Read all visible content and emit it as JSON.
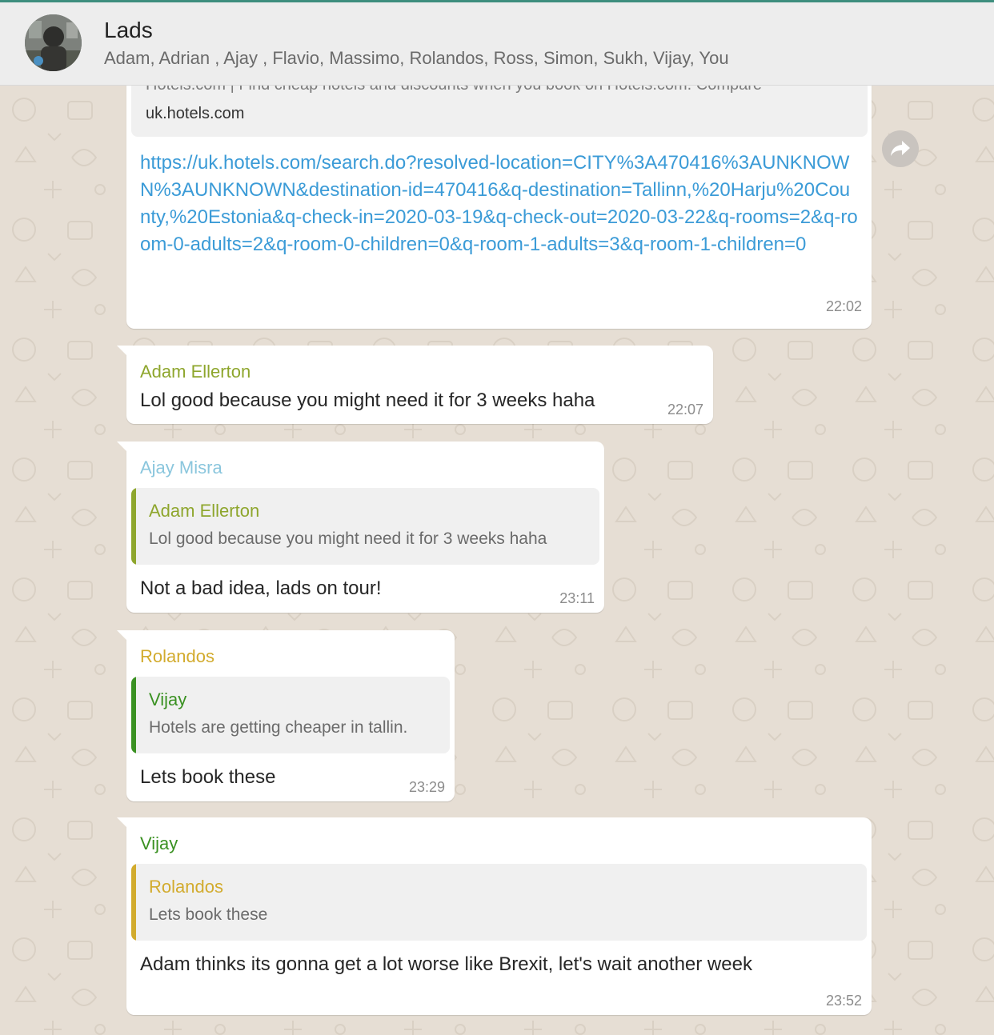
{
  "header": {
    "group_name": "Lads",
    "participants": "Adam, Adrian , Ajay , Flavio, Massimo, Rolandos, Ross, Simon, Sukh, Vijay, You",
    "avatar_icon": "group-avatar"
  },
  "colors": {
    "adam": "#8ea62d",
    "ajay": "#8ac6dd",
    "rolandos": "#d2ab2d",
    "vijay": "#3a9122",
    "link": "#3b9bd7"
  },
  "messages": {
    "m1": {
      "preview_description": "Hotels.com | Find cheap hotels and discounts when you book on Hotels.com. Compare",
      "preview_domain": "uk.hotels.com",
      "link": "https://uk.hotels.com/search.do?resolved-location=CITY%3A470416%3AUNKNOWN%3AUNKNOWN&destination-id=470416&q-destination=Tallinn,%20Harju%20County,%20Estonia&q-check-in=2020-03-19&q-check-out=2020-03-22&q-rooms=2&q-room-0-adults=2&q-room-0-children=0&q-room-1-adults=3&q-room-1-children=0",
      "time": "22:02"
    },
    "m2": {
      "sender": "Adam Ellerton",
      "text": "Lol good because you might need it for 3 weeks haha",
      "time": "22:07"
    },
    "m3": {
      "sender": "Ajay Misra",
      "quote_sender": "Adam Ellerton",
      "quote_text": "Lol good because you might need it for 3 weeks haha",
      "text": "Not a bad idea, lads on tour!",
      "time": "23:11"
    },
    "m4": {
      "sender": "Rolandos",
      "quote_sender": "Vijay",
      "quote_text": "Hotels are getting cheaper in tallin.",
      "text": "Lets book these",
      "time": "23:29"
    },
    "m5": {
      "sender": "Vijay",
      "quote_sender": "Rolandos",
      "quote_text": "Lets book these",
      "text": "Adam thinks its gonna get a lot worse like Brexit, let's wait another week",
      "time": "23:52"
    }
  }
}
